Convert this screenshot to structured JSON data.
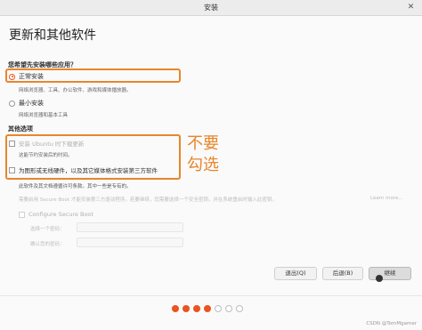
{
  "window": {
    "title": "安装",
    "close_glyph": "✕"
  },
  "page_title": "更新和其他软件",
  "install_question": "您希望先安装哪些应用？",
  "options": {
    "normal": {
      "label": "正常安装",
      "desc": "网络浏览器、工具、办公软件、游戏和媒体播放器。",
      "selected": true
    },
    "minimal": {
      "label": "最小安装",
      "desc": "网络浏览器和基本工具",
      "selected": false
    }
  },
  "other_options": {
    "title": "其他选项",
    "download_updates": {
      "label": "安装 Ubuntu 时下载更新",
      "desc": "这能节约安装后的时间。",
      "checked": false
    },
    "third_party": {
      "label": "为图形或无线硬件，以及其它媒体格式安装第三方软件",
      "desc": "此软件及其文档遵循许可条款。其中一些是专有的。",
      "checked": false
    }
  },
  "annotation": {
    "line1": "不要",
    "line2": "勾选"
  },
  "secure_boot": {
    "note": "需要启用 Secure Boot 才能安装第三方驱动程序。若要继续，您需要选择一个安全密钥，并在系统重启时输入此密钥。",
    "learn_more": "Learn more...",
    "configure_label": "Configure Secure Boot",
    "choose_password_label": "选择一个密码：",
    "confirm_password_label": "确认您的密码："
  },
  "buttons": {
    "quit": "退出(Q)",
    "back": "后退(B)",
    "continue": "继续"
  },
  "progress": {
    "total_steps": 7,
    "completed_steps": 4
  },
  "watermark": "CSDN @TomMgamer",
  "colors": {
    "accent": "#e95420",
    "annotation": "#e8862a"
  }
}
